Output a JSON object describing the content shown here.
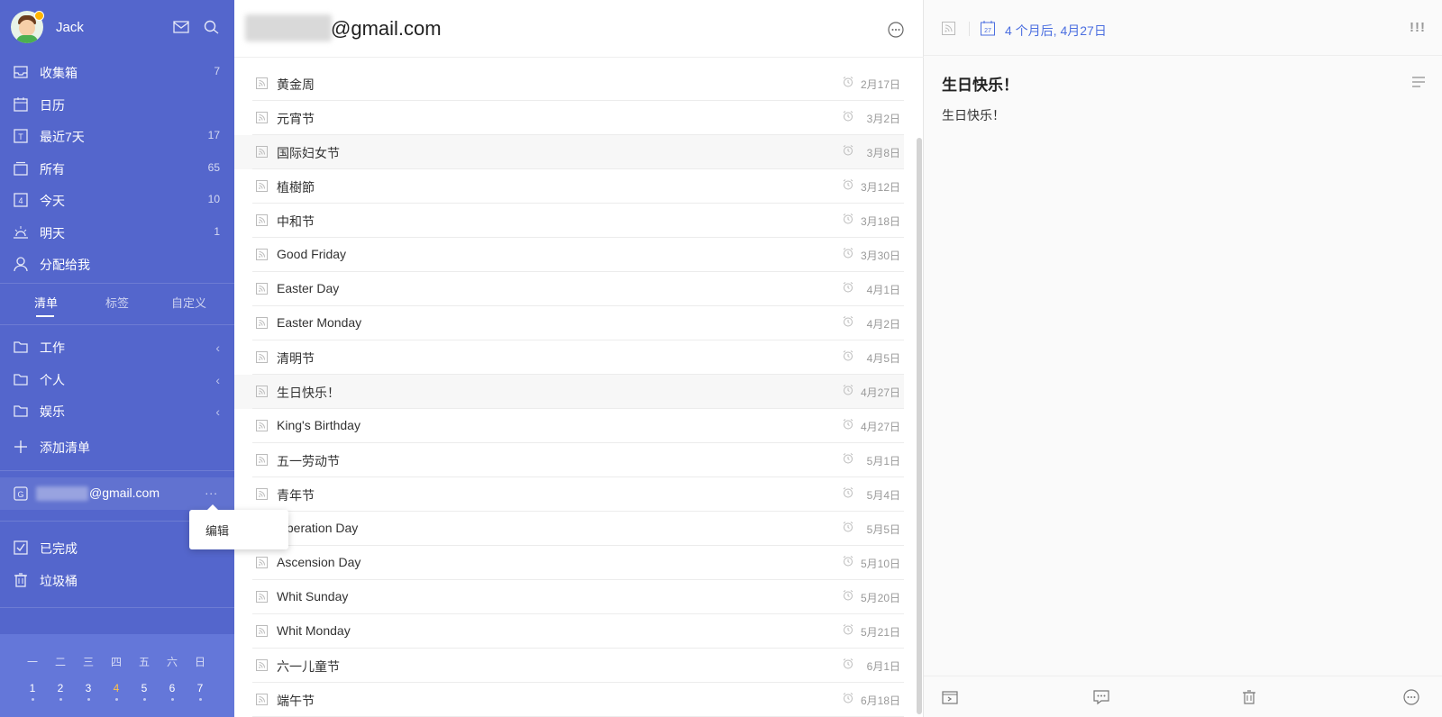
{
  "sidebar": {
    "user_name": "Jack",
    "nav": [
      {
        "label": "收集箱",
        "count": "7",
        "icon": "inbox-icon"
      },
      {
        "label": "日历",
        "count": "",
        "icon": "calendar-icon"
      },
      {
        "label": "最近7天",
        "count": "17",
        "icon": "next-7-days-icon"
      },
      {
        "label": "所有",
        "count": "65",
        "icon": "all-tasks-icon"
      },
      {
        "label": "今天",
        "count": "10",
        "icon": "today-icon"
      },
      {
        "label": "明天",
        "count": "1",
        "icon": "sunrise-icon"
      },
      {
        "label": "分配给我",
        "count": "",
        "icon": "assigned-user-icon"
      }
    ],
    "tabs": [
      "清单",
      "标签",
      "自定义"
    ],
    "folders": [
      {
        "label": "工作"
      },
      {
        "label": "个人"
      },
      {
        "label": "娱乐"
      }
    ],
    "add_list": "添加清单",
    "account_suffix": "@gmail.com",
    "account_more": "...",
    "popup_edit": "编辑",
    "done": "已完成",
    "trash": "垃圾桶",
    "calendar": {
      "weekdays": [
        "一",
        "二",
        "三",
        "四",
        "五",
        "六",
        "日"
      ],
      "days": [
        "1",
        "2",
        "3",
        "4",
        "5",
        "6",
        "7"
      ],
      "today_index": 3
    }
  },
  "list": {
    "title_suffix": "@gmail.com",
    "tasks": [
      {
        "title": "黄金周",
        "date": "2月17日"
      },
      {
        "title": "元宵节",
        "date": "3月2日"
      },
      {
        "title": "国际妇女节",
        "date": "3月8日"
      },
      {
        "title": "植樹節",
        "date": "3月12日"
      },
      {
        "title": "中和节",
        "date": "3月18日"
      },
      {
        "title": "Good Friday",
        "date": "3月30日"
      },
      {
        "title": "Easter Day",
        "date": "4月1日"
      },
      {
        "title": "Easter Monday",
        "date": "4月2日"
      },
      {
        "title": "清明节",
        "date": "4月5日"
      },
      {
        "title": "生日快乐！",
        "date": "4月27日"
      },
      {
        "title": "King's Birthday",
        "date": "4月27日"
      },
      {
        "title": "五一劳动节",
        "date": "5月1日"
      },
      {
        "title": "青年节",
        "date": "5月4日"
      },
      {
        "title": "Liberation Day",
        "date": "5月5日"
      },
      {
        "title": "Ascension Day",
        "date": "5月10日"
      },
      {
        "title": "Whit Sunday",
        "date": "5月20日"
      },
      {
        "title": "Whit Monday",
        "date": "5月21日"
      },
      {
        "title": "六一儿童节",
        "date": "6月1日"
      },
      {
        "title": "端午节",
        "date": "6月18日"
      }
    ]
  },
  "detail": {
    "due": "4 个月后, 4月27日",
    "cal_day": "27",
    "priority": "!!!",
    "title": "生日快乐！",
    "note": "生日快乐！"
  },
  "colors": {
    "sidebar": "#5466cc",
    "accent": "#4c6fe0",
    "today": "#ffc247"
  }
}
